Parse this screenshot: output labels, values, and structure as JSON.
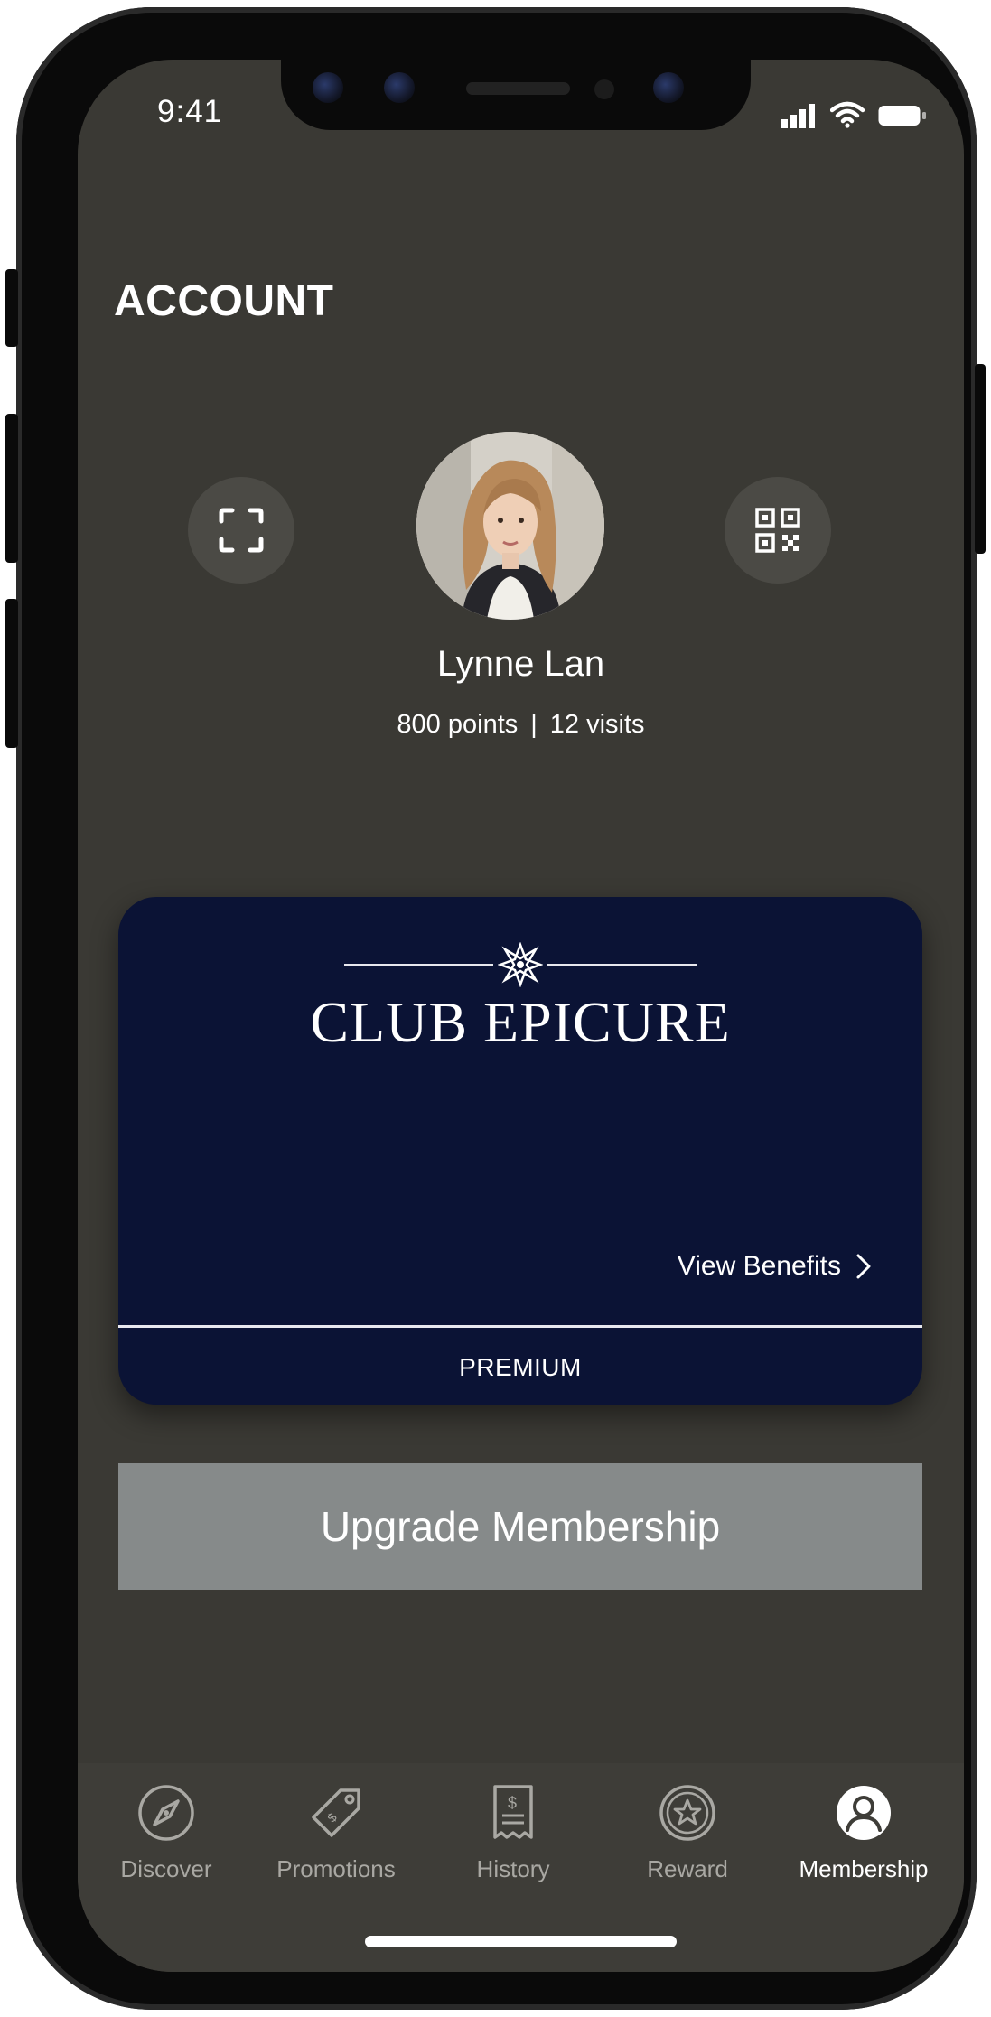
{
  "status_bar": {
    "time": "9:41"
  },
  "header": {
    "title": "ACCOUNT"
  },
  "profile": {
    "name": "Lynne Lan",
    "points": "800 points",
    "separator": "|",
    "visits": "12 visits"
  },
  "card": {
    "brand": "CLUB EPICURE",
    "view_benefits": "View Benefits",
    "tier": "PREMIUM",
    "color": "#0b1335"
  },
  "actions": {
    "upgrade": "Upgrade Membership"
  },
  "tabs": [
    {
      "label": "Discover",
      "icon": "compass-icon"
    },
    {
      "label": "Promotions",
      "icon": "tag-icon"
    },
    {
      "label": "History",
      "icon": "receipt-icon"
    },
    {
      "label": "Reward",
      "icon": "star-badge-icon"
    },
    {
      "label": "Membership",
      "icon": "user-icon",
      "active": true
    }
  ],
  "theme": {
    "background": "#3a3934",
    "button_gray": "#868a8a",
    "accent_white": "#ffffff"
  }
}
